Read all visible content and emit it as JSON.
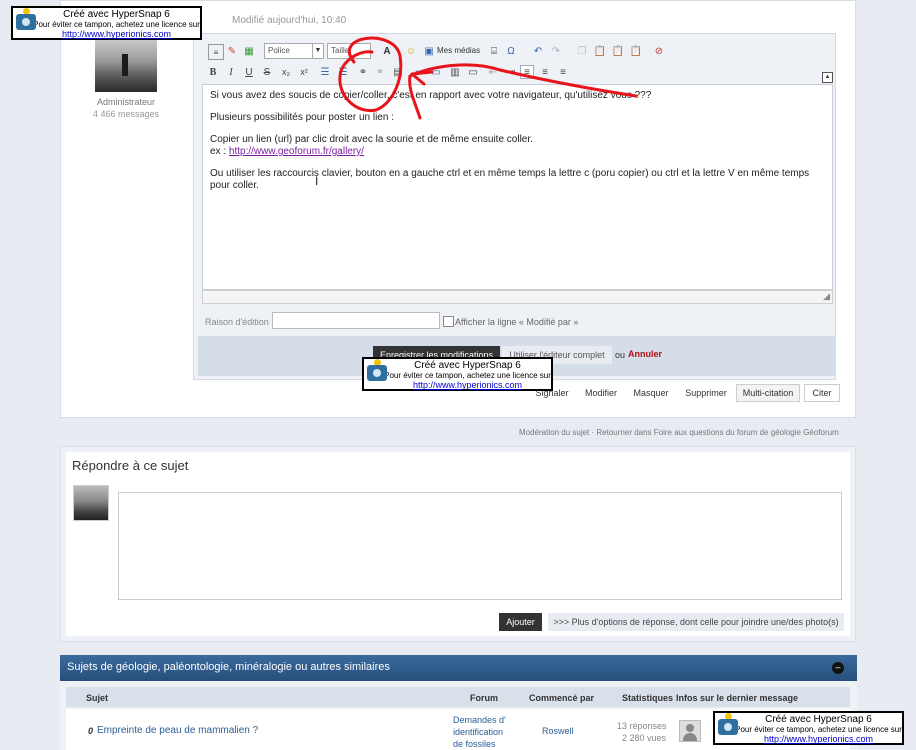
{
  "post": {
    "date": "Modifié aujourd'hui, 10:40",
    "author_role": "Administrateur",
    "author_messages": "4 466 messages"
  },
  "editor": {
    "font_select": "Police",
    "size_select": "Taille",
    "media_label": "Mes médias",
    "content": {
      "p1": "Si vous avez des soucis de copier/coller, c'est en rapport avec votre navigateur, qu'utilisez vous ???",
      "p2": "Plusieurs possibilités pour poster un lien :",
      "p3": "Copier un lien (url) par clic droit avec la sourie et de même ensuite coller.",
      "p4_prefix": "ex : ",
      "p4_link": "http://www.geoforum.fr/gallery/",
      "p5": "Ou utiliser les raccourcis clavier, bouton en a gauche ctrl et en même temps la lettre c (poru copier) ou ctrl et la lettre V en même temps pour coller."
    },
    "reason_label": "Raison d'édition :",
    "reason_value": "",
    "show_line_label": "Afficher la ligne « Modifié par »",
    "save_button": "Enregistrer les modifications",
    "full_editor_button": "Utiliser l'éditeur complet",
    "or_text": "ou",
    "cancel_link": "Annuler"
  },
  "post_actions": [
    "Signaler",
    "Modifier",
    "Masquer",
    "Supprimer",
    "Multi-citation",
    "Citer"
  ],
  "breadcrumb": {
    "moderation": "Modération du sujet",
    "separator": "·",
    "back": "Retourner dans Foire aux questions du forum de géologie Géoforum"
  },
  "reply": {
    "title": "Répondre à ce sujet",
    "add_button": "Ajouter",
    "more_options": ">>> Plus d'options de réponse, dont celle pour joindre une/des photo(s)"
  },
  "topics": {
    "title": "Sujets de géologie, paléontologie, minéralogie ou autres similaires",
    "columns": [
      "Sujet",
      "Forum",
      "Commencé par",
      "Statistiques",
      "Infos sur le dernier message"
    ],
    "rows": [
      {
        "subject": "Empreinte de peau de mammalien ?",
        "forum": "Demandes d' identification de fossiles",
        "started_by": "Roswell",
        "replies": "13 réponses",
        "views": "2 280 vues"
      }
    ]
  },
  "watermark": {
    "line1": "Créé avec HyperSnap 6",
    "line2": "Pour éviter ce tampon, achetez une licence sur",
    "line3": "http://www.hyperionics.com"
  },
  "colors": {
    "annotation_red": "#e8141b",
    "header_blue": "#2c5a8a",
    "link_purple": "#7a1ea1",
    "cancel_red": "#b01010"
  }
}
